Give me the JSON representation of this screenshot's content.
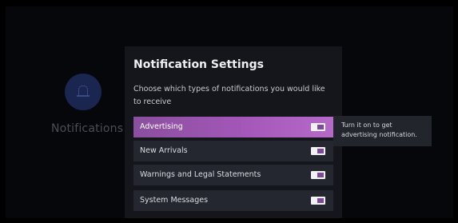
{
  "background": {
    "icon": "bell-icon",
    "label": "Notifications"
  },
  "dialog": {
    "title": "Notification Settings",
    "description": "Choose which types of notifications you would like to receive",
    "options": [
      {
        "label": "Advertising",
        "enabled": true,
        "focused": true
      },
      {
        "label": "New Arrivals",
        "enabled": true,
        "focused": false
      },
      {
        "label": "Warnings and Legal Statements",
        "enabled": true,
        "focused": false
      },
      {
        "label": "System Messages",
        "enabled": true,
        "focused": false
      }
    ]
  },
  "tooltip": {
    "text": "Turn it on to get advertising notification."
  },
  "colors": {
    "focus_gradient_start": "#8a4f9e",
    "focus_gradient_end": "#b56ac8",
    "toggle_on": "#f2f2f4",
    "toggle_knob": "#7b4a98"
  }
}
